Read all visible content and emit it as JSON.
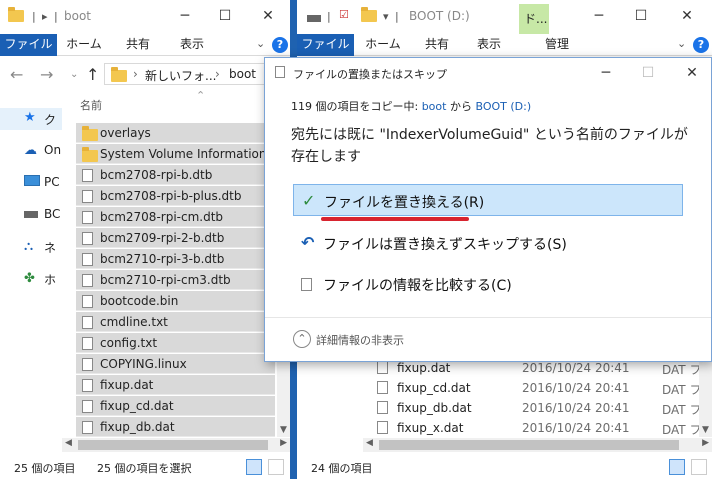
{
  "left_window": {
    "title": "boot",
    "ribbon": {
      "file": "ファイル",
      "home": "ホーム",
      "share": "共有",
      "view": "表示",
      "help": "?"
    },
    "breadcrumb": {
      "part1": "新しいフォ...",
      "sep": "›",
      "part2": "boot"
    },
    "column_name": "名前",
    "nav_items": [
      "ク",
      "On",
      "PC",
      "BC",
      "ネ",
      "ホ"
    ],
    "files": [
      {
        "name": "overlays",
        "kind": "folder"
      },
      {
        "name": "System Volume Information",
        "kind": "folder"
      },
      {
        "name": "bcm2708-rpi-b.dtb",
        "kind": "file"
      },
      {
        "name": "bcm2708-rpi-b-plus.dtb",
        "kind": "file"
      },
      {
        "name": "bcm2708-rpi-cm.dtb",
        "kind": "file"
      },
      {
        "name": "bcm2709-rpi-2-b.dtb",
        "kind": "file"
      },
      {
        "name": "bcm2710-rpi-3-b.dtb",
        "kind": "file"
      },
      {
        "name": "bcm2710-rpi-cm3.dtb",
        "kind": "file"
      },
      {
        "name": "bootcode.bin",
        "kind": "file"
      },
      {
        "name": "cmdline.txt",
        "kind": "file"
      },
      {
        "name": "config.txt",
        "kind": "file"
      },
      {
        "name": "COPYING.linux",
        "kind": "file"
      },
      {
        "name": "fixup.dat",
        "kind": "file"
      },
      {
        "name": "fixup_cd.dat",
        "kind": "file"
      },
      {
        "name": "fixup_db.dat",
        "kind": "file"
      }
    ],
    "status_count": "25 個の項目",
    "status_selected": "25 個の項目を選択"
  },
  "right_window": {
    "title": "BOOT (D:)",
    "context_tab": "ド...",
    "ribbon": {
      "file": "ファイル",
      "home": "ホーム",
      "share": "共有",
      "view": "表示",
      "manage": "管理",
      "help": "?"
    },
    "files": [
      {
        "name": "fixup.dat",
        "date": "2016/10/24 20:41",
        "type": "DAT フ"
      },
      {
        "name": "fixup_cd.dat",
        "date": "2016/10/24 20:41",
        "type": "DAT フ"
      },
      {
        "name": "fixup_db.dat",
        "date": "2016/10/24 20:41",
        "type": "DAT フ"
      },
      {
        "name": "fixup_x.dat",
        "date": "2016/10/24 20:41",
        "type": "DAT フ"
      }
    ],
    "status_count": "24 個の項目"
  },
  "dialog": {
    "title": "ファイルの置換またはスキップ",
    "summary": {
      "prefix": "119 個の項目をコピー中: ",
      "from": "boot",
      "mid": " から ",
      "to": "BOOT (D:)"
    },
    "message": "宛先には既に \"IndexerVolumeGuid\" という名前のファイルが存在します",
    "options": {
      "replace": "ファイルを置き換える(R)",
      "skip": "ファイルは置き換えずスキップする(S)",
      "compare": "ファイルの情報を比較する(C)"
    },
    "details_toggle": "詳細情報の非表示"
  },
  "colors": {
    "accent": "#1a5fb4",
    "selection": "#cce6fb",
    "highlight_mark": "#d8242f",
    "check": "#2e8b3e"
  },
  "icons": {
    "replace": "check-icon",
    "skip": "undo-arrow-icon",
    "compare": "file-compare-icon"
  }
}
